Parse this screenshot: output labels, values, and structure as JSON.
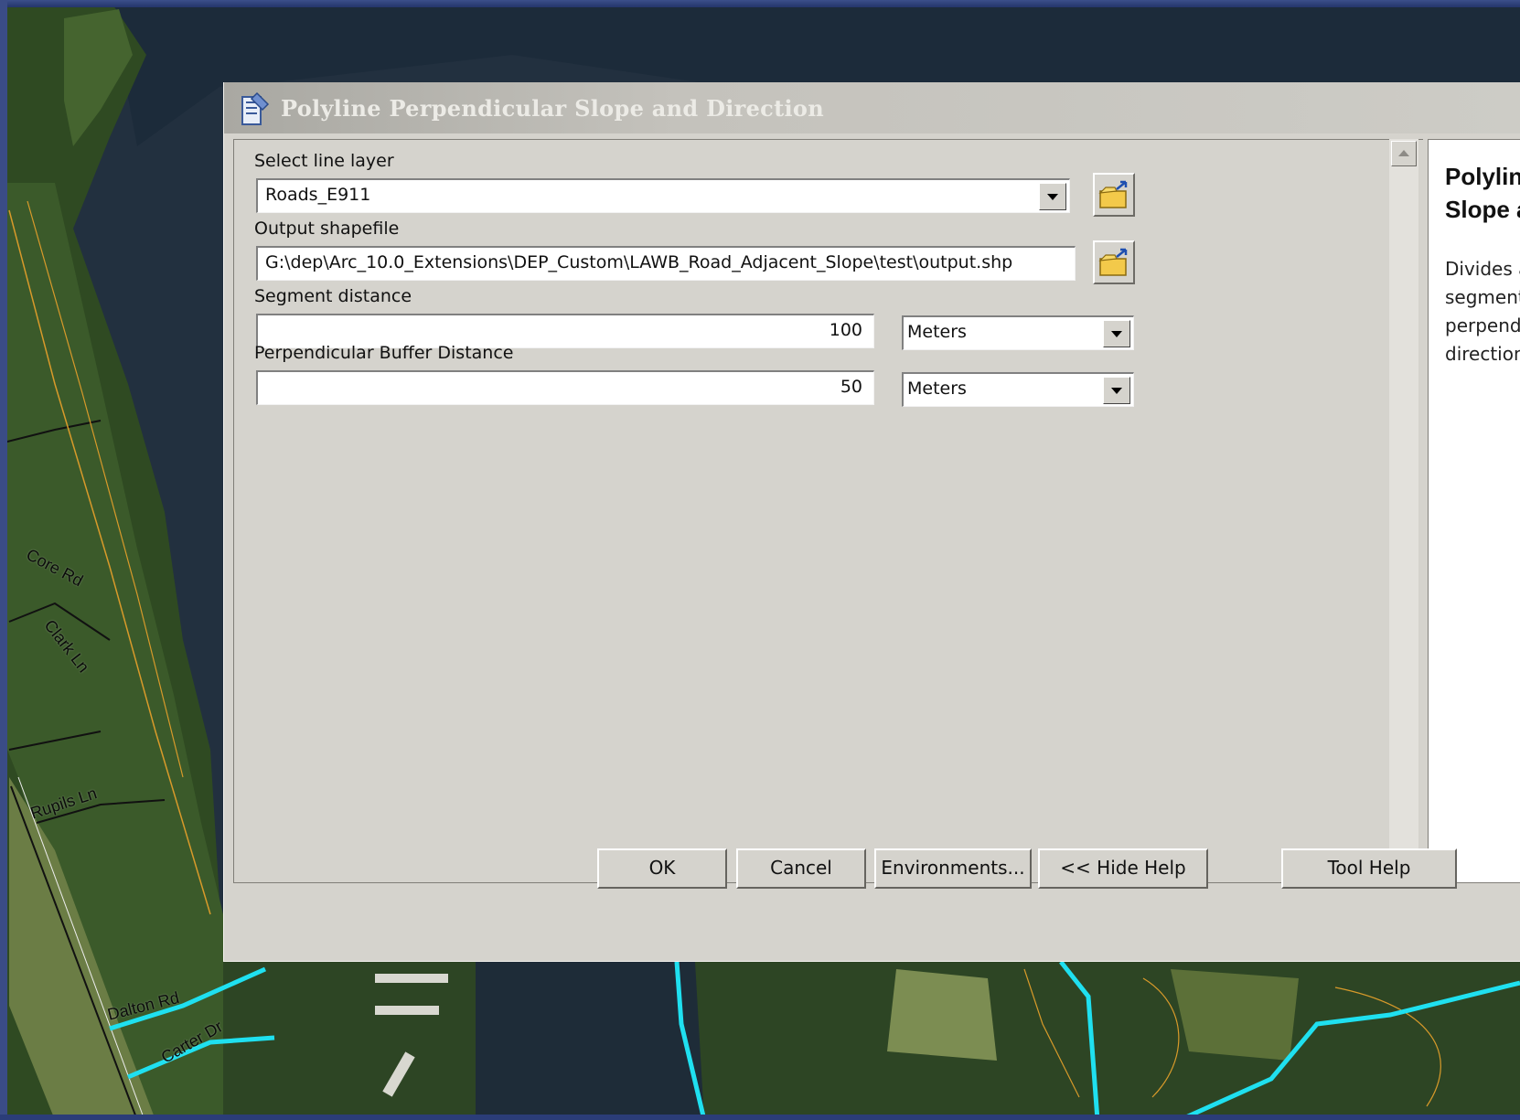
{
  "dialog": {
    "title": "Polyline Perpendicular Slope and Direction"
  },
  "form": {
    "line_layer": {
      "label": "Select line layer",
      "value": "Roads_E911"
    },
    "output": {
      "label": "Output shapefile",
      "value": "G:\\dep\\Arc_10.0_Extensions\\DEP_Custom\\LAWB_Road_Adjacent_Slope\\test\\output.shp"
    },
    "segment": {
      "label": "Segment distance",
      "value": "100",
      "unit": "Meters"
    },
    "buffer": {
      "label": "Perpendicular Buffer Distance",
      "value": "50",
      "unit": "Meters"
    }
  },
  "help": {
    "title_line1": "Polyline Perpend",
    "title_line2": "Slope and Direct",
    "body_lines": [
      "Divides a line into equ",
      "segments and compu",
      "perpendicular slope a",
      "direction."
    ]
  },
  "buttons": {
    "ok": "OK",
    "cancel": "Cancel",
    "environments": "Environments...",
    "hide_help": "<< Hide Help",
    "tool_help": "Tool Help"
  },
  "map_labels": {
    "core_rd": "Core Rd",
    "clark_ln": "Clark Ln",
    "rupils_ln": "Rupils Ln",
    "dalton_rd": "Dalton Rd",
    "carter_dr": "Carter Dr"
  },
  "icons": {
    "dialog_tool": "tool-script-icon",
    "browse": "folder-open-icon"
  },
  "colors": {
    "dialog_bg": "#d5d3cd",
    "map_water": "#1f2c3c",
    "map_vegetation": "#2e4a22",
    "road_highlight": "#1fe0f0",
    "parcel_lines": "#d89a2a"
  }
}
